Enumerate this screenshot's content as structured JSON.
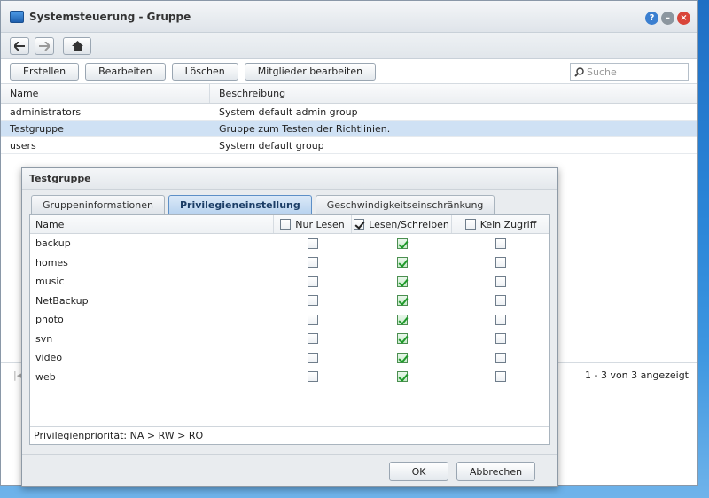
{
  "window": {
    "title": "Systemsteuerung - Gruppe"
  },
  "toolbar": {
    "buttons": [
      "Erstellen",
      "Bearbeiten",
      "Löschen",
      "Mitglieder bearbeiten"
    ],
    "search_placeholder": "Suche"
  },
  "grid": {
    "headers": [
      "Name",
      "Beschreibung"
    ],
    "rows": [
      {
        "name": "administrators",
        "desc": "System default admin group"
      },
      {
        "name": "Testgruppe",
        "desc": "Gruppe zum Testen der Richtlinien."
      },
      {
        "name": "users",
        "desc": "System default group"
      }
    ],
    "selected_row": "Testgruppe",
    "pager": "1 - 3 von 3 angezeigt"
  },
  "dialog": {
    "title": "Testgruppe",
    "tabs": [
      "Gruppeninformationen",
      "Privilegieneinstellung",
      "Geschwindigkeitseinschränkung"
    ],
    "active_tab": "Privilegieneinstellung",
    "columns": {
      "name": "Name",
      "ro": "Nur Lesen",
      "rw": "Lesen/Schreiben",
      "na": "Kein Zugriff"
    },
    "header_checks": {
      "ro": false,
      "rw": true,
      "na": false
    },
    "shares": [
      {
        "name": "backup",
        "ro": false,
        "rw": true,
        "na": false
      },
      {
        "name": "homes",
        "ro": false,
        "rw": true,
        "na": false
      },
      {
        "name": "music",
        "ro": false,
        "rw": true,
        "na": false
      },
      {
        "name": "NetBackup",
        "ro": false,
        "rw": true,
        "na": false
      },
      {
        "name": "photo",
        "ro": false,
        "rw": true,
        "na": false
      },
      {
        "name": "svn",
        "ro": false,
        "rw": true,
        "na": false
      },
      {
        "name": "video",
        "ro": false,
        "rw": true,
        "na": false
      },
      {
        "name": "web",
        "ro": false,
        "rw": true,
        "na": false
      }
    ],
    "footer_note": "Privilegienpriorität: NA > RW > RO",
    "ok_label": "OK",
    "cancel_label": "Abbrechen"
  },
  "colors": {
    "accent": "#5d8fc7",
    "selected_row": "#cfe1f4",
    "check": "#1f9a2a",
    "desktop": "#2b86d8"
  }
}
